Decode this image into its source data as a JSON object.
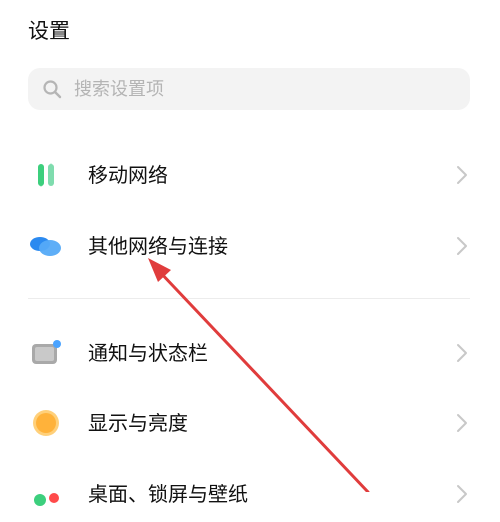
{
  "header": {
    "title": "设置"
  },
  "search": {
    "placeholder": "搜索设置项",
    "value": "",
    "icon": "search-icon"
  },
  "settings_items": [
    {
      "label": "移动网络",
      "icon": "mobile-network-icon",
      "icon_colors": [
        "#3ccf7d",
        "#6bd3a5"
      ]
    },
    {
      "label": "其他网络与连接",
      "icon": "connections-icon",
      "icon_colors": [
        "#2b8af0",
        "#7fc2ff"
      ]
    },
    {
      "label": "通知与状态栏",
      "icon": "notification-icon",
      "icon_colors": [
        "#9a9a9a",
        "#4aa3ff"
      ]
    },
    {
      "label": "显示与亮度",
      "icon": "brightness-icon",
      "icon_colors": [
        "#ffb23a",
        "#ffd07a"
      ]
    },
    {
      "label": "桌面、锁屏与壁纸",
      "icon": "wallpaper-icon",
      "icon_colors": [
        "#3ccf7d",
        "#ff4a4a"
      ]
    }
  ],
  "annotation": {
    "arrow_color": "#e03c3c",
    "points_to": "其他网络与连接"
  }
}
